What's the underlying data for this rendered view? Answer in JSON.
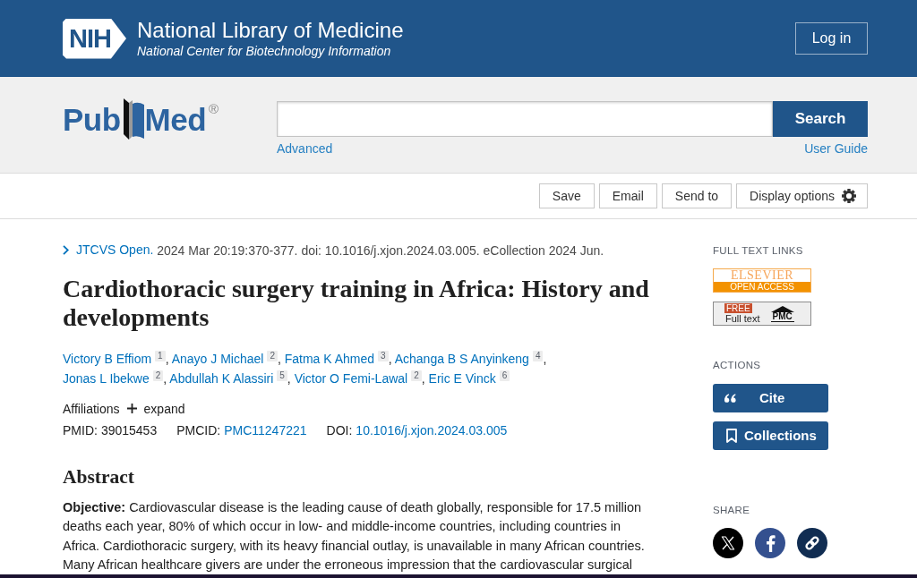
{
  "header": {
    "logo": "NIH",
    "title": "National Library of Medicine",
    "subtitle": "National Center for Biotechnology Information",
    "login_button": "Log in"
  },
  "search_bar": {
    "logo": {
      "parts": [
        "Pub",
        "Med"
      ],
      "mark": "®"
    },
    "search_button": "Search",
    "links": [
      {
        "label": "Advanced"
      },
      {
        "label": "User Guide"
      }
    ]
  },
  "toolbar": {
    "buttons": [
      {
        "label": "Save",
        "kind": "plain"
      },
      {
        "label": "Email",
        "kind": "plain"
      },
      {
        "label": "Send to",
        "kind": "plain"
      },
      {
        "label": "Display options",
        "kind": "settings"
      }
    ]
  },
  "article": {
    "journal": "JTCVS Open.",
    "citation": "2024 Mar 20:19:370-377. doi: 10.1016/j.xjon.2024.03.005. eCollection 2024 Jun.",
    "title": "Cardiothoracic surgery training in Africa: History and developments",
    "authors": [
      {
        "name": "Victory B Effiom",
        "affiliation": "1"
      },
      {
        "name": "Anayo J Michael",
        "affiliation": "2"
      },
      {
        "name": "Fatma K Ahmed",
        "affiliation": "3"
      },
      {
        "name": "Achanga B S Anyinkeng",
        "affiliation": "4"
      },
      {
        "name": "Jonas L Ibekwe",
        "affiliation": "2"
      },
      {
        "name": "Abdullah K Alassiri",
        "affiliation": "5"
      },
      {
        "name": "Victor O Femi-Lawal",
        "affiliation": "2"
      },
      {
        "name": "Eric E Vinck",
        "affiliation": "6"
      }
    ],
    "author_separator": ",",
    "affiliations": {
      "label": "Affiliations",
      "toggle": "expand"
    },
    "identifiers": [
      {
        "label": "PMID:",
        "value": "39015453",
        "kind": "text"
      },
      {
        "label": "PMCID:",
        "value": "PMC11247221",
        "kind": "link"
      },
      {
        "label": "DOI:",
        "value": "10.1016/j.xjon.2024.03.005",
        "kind": "link"
      }
    ]
  },
  "abstract": {
    "heading": "Abstract",
    "paragraphs": [
      "**Objective:** Cardiovascular disease is the leading cause of death globally, responsible for 17.5 million deaths each year, 80% of which occur in low- and middle-income countries, including countries in Africa. Cardiothoracic surgery, with its heavy financial outlay, is unavailable in many African countries. Many African healthcare givers are under the erroneous impression that the cardiovascular surgical"
    ]
  },
  "sidebar": {
    "full_text_links": {
      "heading": "FULL TEXT LINKS",
      "links": [
        {
          "kind": "publisher",
          "name": "ELSEVIER",
          "band": "OPEN ACCESS"
        },
        {
          "kind": "repository",
          "badge": "FREE",
          "label": "Full text",
          "logo": "PMC"
        }
      ]
    },
    "actions": {
      "heading": "ACTIONS",
      "buttons": [
        {
          "kind": "cite",
          "label": "Cite"
        },
        {
          "kind": "collections",
          "label": "Collections"
        }
      ]
    },
    "share": {
      "heading": "SHARE",
      "buttons": [
        {
          "kind": "x"
        },
        {
          "kind": "facebook"
        },
        {
          "kind": "link"
        }
      ]
    }
  }
}
